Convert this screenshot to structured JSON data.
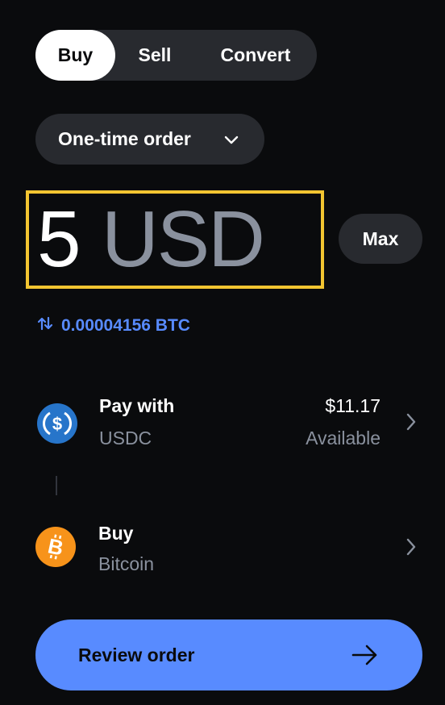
{
  "tabs": [
    {
      "label": "Buy",
      "active": true
    },
    {
      "label": "Sell",
      "active": false
    },
    {
      "label": "Convert",
      "active": false
    }
  ],
  "order_type": {
    "label": "One-time order",
    "icon": "chevron-down-icon"
  },
  "amount": {
    "value": "5",
    "currency": "USD"
  },
  "max_button": {
    "label": "Max"
  },
  "conversion": {
    "text": "0.00004156 BTC",
    "icon": "swap-arrows-icon"
  },
  "pay_with": {
    "title": "Pay with",
    "asset": "USDC",
    "balance": "$11.17",
    "balance_label": "Available",
    "icon": "usdc-coin-icon"
  },
  "buy_asset": {
    "title": "Buy",
    "asset": "Bitcoin",
    "icon": "bitcoin-coin-icon"
  },
  "review_button": {
    "label": "Review order",
    "icon": "arrow-right-icon"
  },
  "colors": {
    "background": "#0a0b0d",
    "surface": "#282a2f",
    "accent_blue": "#588bff",
    "highlight_yellow": "#f3c531",
    "muted_text": "#8a919e",
    "usdc_blue": "#2775ca",
    "bitcoin_orange": "#f7931a"
  }
}
